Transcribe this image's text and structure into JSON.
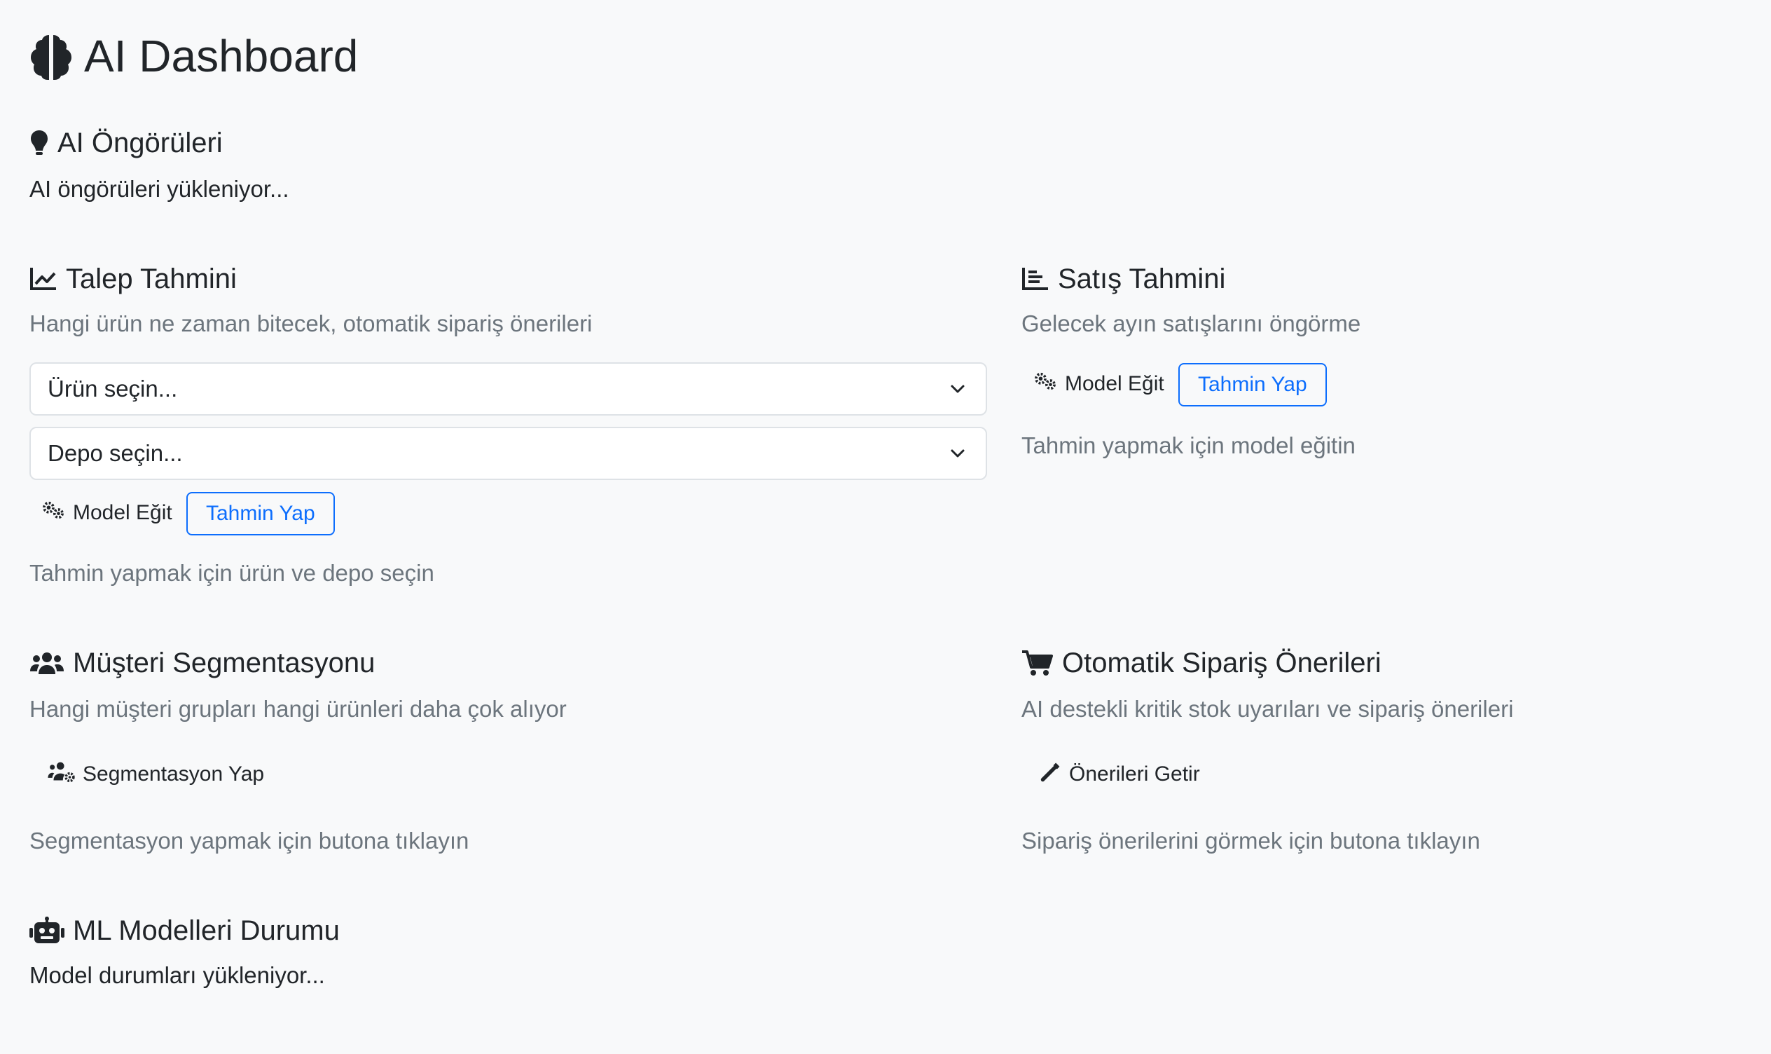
{
  "header": {
    "title": "AI Dashboard",
    "icon": "brain-icon"
  },
  "insights": {
    "title": "AI Öngörüleri",
    "icon": "lightbulb-icon",
    "status": "AI öngörüleri yükleniyor..."
  },
  "demand": {
    "title": "Talep Tahmini",
    "icon": "chart-line-icon",
    "subtitle": "Hangi ürün ne zaman bitecek, otomatik sipariş önerileri",
    "product_select": "Ürün seçin...",
    "warehouse_select": "Depo seçin...",
    "train_label": "Model Eğit",
    "predict_label": "Tahmin Yap",
    "hint": "Tahmin yapmak için ürün ve depo seçin"
  },
  "sales": {
    "title": "Satış Tahmini",
    "icon": "chart-bar-icon",
    "subtitle": "Gelecek ayın satışlarını öngörme",
    "train_label": "Model Eğit",
    "predict_label": "Tahmin Yap",
    "hint": "Tahmin yapmak için model eğitin"
  },
  "segmentation": {
    "title": "Müşteri Segmentasyonu",
    "icon": "users-icon",
    "subtitle": "Hangi müşteri grupları hangi ürünleri daha çok alıyor",
    "button_label": "Segmentasyon Yap",
    "hint": "Segmentasyon yapmak için butona tıklayın"
  },
  "auto_order": {
    "title": "Otomatik Sipariş Önerileri",
    "icon": "cart-icon",
    "subtitle": "AI destekli kritik stok uyarıları ve sipariş önerileri",
    "button_label": "Önerileri Getir",
    "hint": "Sipariş önerilerini görmek için butona tıklayın"
  },
  "ml_models": {
    "title": "ML Modelleri Durumu",
    "icon": "robot-icon",
    "status": "Model durumları yükleniyor..."
  },
  "colors": {
    "accent": "#0d6efd",
    "muted": "#6c757d",
    "text": "#212529",
    "background": "#f8f9fa"
  }
}
